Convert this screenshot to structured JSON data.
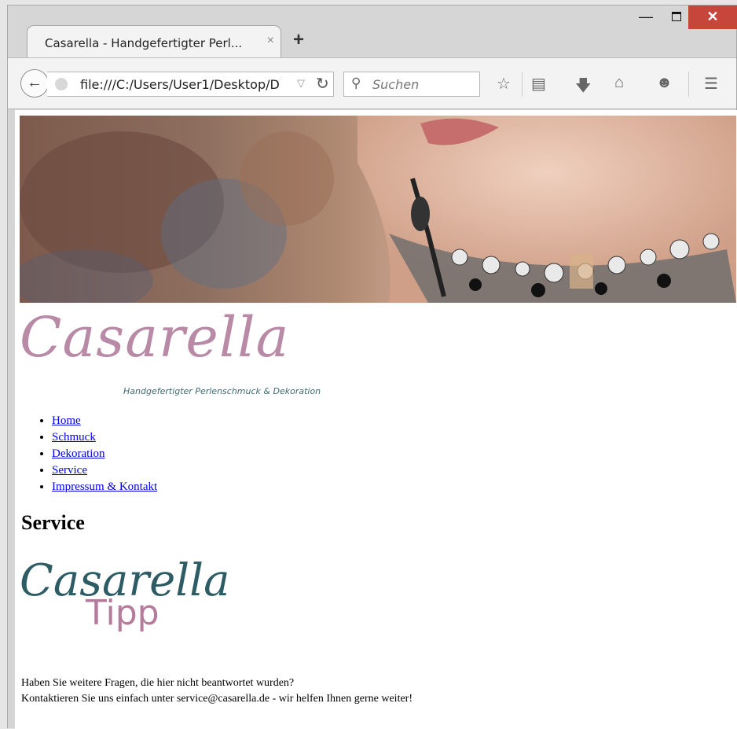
{
  "browser": {
    "tab_title": "Casarella - Handgefertigter Perl...",
    "tab_close": "×",
    "new_tab": "+",
    "url": "file:///C:/Users/User1/Desktop/D",
    "search_placeholder": "Suchen"
  },
  "page": {
    "logo_text": "Casarella",
    "logo_tagline": "Handgefertigter Perlenschmuck & Dekoration",
    "nav": [
      "Home",
      "Schmuck",
      "Dekoration",
      "Service",
      "Impressum & Kontakt"
    ],
    "heading": "Service",
    "tipp_script": "Casarella",
    "tipp_word": "Tipp",
    "text_line1": "Haben Sie weitere Fragen, die hier nicht beantwortet wurden?",
    "text_line2": "Kontaktieren Sie uns einfach unter service@casarella.de - wir helfen Ihnen gerne weiter!"
  },
  "colors": {
    "link": "#0000ee",
    "logo_pink": "#b88aa6",
    "logo_teal": "#2e5c64",
    "close_red": "#c7463c"
  }
}
